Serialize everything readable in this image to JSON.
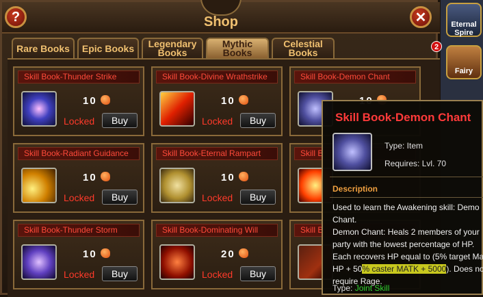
{
  "window": {
    "title": "Shop",
    "help_label": "?",
    "close_label": "✕"
  },
  "tabs": [
    {
      "label": "Rare Books"
    },
    {
      "label": "Epic Books"
    },
    {
      "label": "Legendary Books"
    },
    {
      "label": "Mythic Books"
    },
    {
      "label": "Celestial Books"
    }
  ],
  "active_tab": "Mythic Books",
  "items": [
    {
      "name": "Skill Book-Thunder Strike",
      "price": "10",
      "status": "Locked",
      "button": "Buy",
      "icon": "thunder-strike-icon"
    },
    {
      "name": "Skill Book-Divine Wrathstrike",
      "price": "10",
      "status": "Locked",
      "button": "Buy",
      "icon": "divine-wrathstrike-icon"
    },
    {
      "name": "Skill Book-Demon Chant",
      "price": "10",
      "status": "",
      "button": "",
      "icon": "demon-chant-icon"
    },
    {
      "name": "Skill Book-Radiant Guidance",
      "price": "10",
      "status": "Locked",
      "button": "Buy",
      "icon": "radiant-guidance-icon"
    },
    {
      "name": "Skill Book-Eternal Rampart",
      "price": "10",
      "status": "Locked",
      "button": "Buy",
      "icon": "eternal-rampart-icon"
    },
    {
      "name": "Skill B",
      "price": "",
      "status": "",
      "button": "",
      "icon": "skill-book-icon"
    },
    {
      "name": "Skill Book-Thunder Storm",
      "price": "10",
      "status": "Locked",
      "button": "Buy",
      "icon": "thunder-storm-icon"
    },
    {
      "name": "Skill Book-Dominating Will",
      "price": "20",
      "status": "Locked",
      "button": "Buy",
      "icon": "dominating-will-icon"
    },
    {
      "name": "Skill B",
      "price": "",
      "status": "",
      "button": "",
      "icon": "skill-book-icon"
    }
  ],
  "sidebar": {
    "eternal_spire": "Eternal Spire",
    "fairy": "Fairy",
    "badge": "2"
  },
  "tooltip": {
    "title": "Skill Book-Demon Chant",
    "type": "Type: Item",
    "requires": "Requires: Lvl. 70",
    "description_heading": "Description",
    "description_lines": [
      "Used to learn the Awakening skill: Demo",
      "Chant.",
      "Demon Chant: Heals 2 members of your",
      "party with the lowest percentage of HP.",
      "Each recovers HP equal to (5% target Ma"
    ],
    "hp_prefix": "HP + 50",
    "hp_highlight": "% caster MATK + 5000",
    "hp_suffix": "). Does no",
    "rage_line": "require Rage.",
    "skill_type_label": "Type: ",
    "skill_type_value": "Joint Skill"
  },
  "colors": {
    "item_name": "#ff4a3a",
    "locked": "#ff3a2a",
    "title": "#f0c070",
    "joint": "#30d030",
    "highlight": "#c8c81e"
  }
}
